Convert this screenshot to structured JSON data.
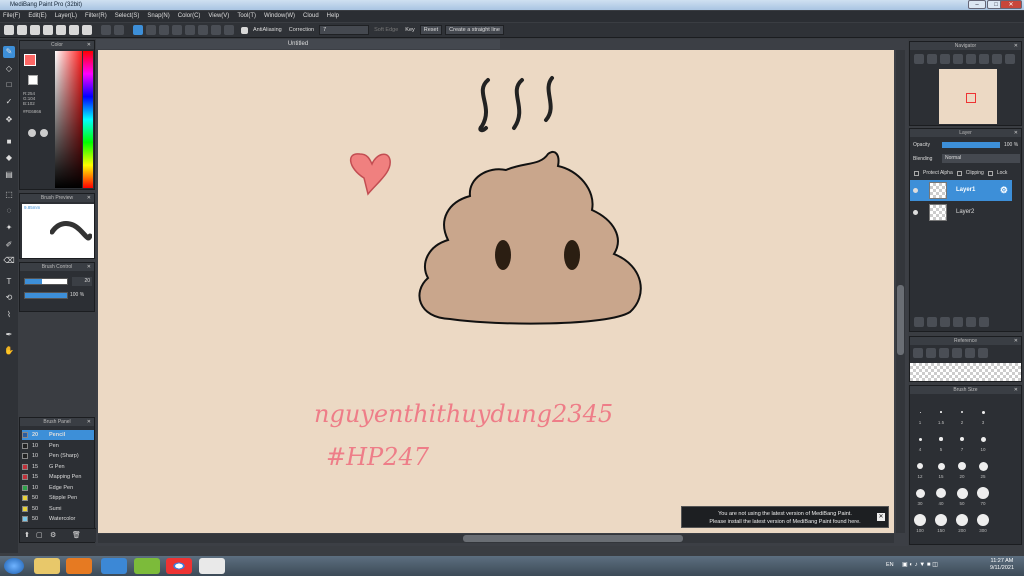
{
  "window": {
    "title": "MediBang Paint Pro (32bit)",
    "tab_title": "Untitled"
  },
  "menu": [
    "File(F)",
    "Edit(E)",
    "Layer(L)",
    "Filter(R)",
    "Select(S)",
    "Snap(N)",
    "Color(C)",
    "View(V)",
    "Tool(T)",
    "Window(W)",
    "Cloud",
    "Help"
  ],
  "toolbar": {
    "antialiasing": "AntiAliasing",
    "correction_label": "Correction",
    "correction_value": "7",
    "soft_edge": "Soft Edge",
    "key_label": "Key",
    "reset_label": "Reset",
    "straight_line": "Create a straight line"
  },
  "color_panel": {
    "title": "Color",
    "r": "R:254",
    "g": "G:104",
    "b": "B:102",
    "hex": "#FE6866",
    "fg": "#fe6866"
  },
  "brush_preview": {
    "title": "Brush Preview",
    "size": "9.85mm"
  },
  "brush_control": {
    "title": "Brush Control",
    "size": "20",
    "opacity": "100 %"
  },
  "brush_panel": {
    "title": "Brush Panel",
    "items": [
      {
        "size": "20",
        "name": "Pencil",
        "color": "#2a5ea0"
      },
      {
        "size": "10",
        "name": "Pen",
        "color": "#222222"
      },
      {
        "size": "10",
        "name": "Pen (Sharp)",
        "color": "#222222"
      },
      {
        "size": "15",
        "name": "G Pen",
        "color": "#c0303a"
      },
      {
        "size": "15",
        "name": "Mapping Pen",
        "color": "#c0303a"
      },
      {
        "size": "10",
        "name": "Edge Pen",
        "color": "#2ea24a"
      },
      {
        "size": "50",
        "name": "Stipple Pen",
        "color": "#e8d23a"
      },
      {
        "size": "50",
        "name": "Sumi",
        "color": "#e8d23a"
      },
      {
        "size": "50",
        "name": "Watercolor",
        "color": "#7ac6e8"
      }
    ]
  },
  "navigator": {
    "title": "Navigator"
  },
  "layer_panel": {
    "title": "Layer",
    "opacity_label": "Opacity",
    "opacity_value": "100 %",
    "blending_label": "Blending",
    "blending_value": "Normal",
    "protect_alpha": "Protect Alpha",
    "clipping": "Clipping",
    "lock": "Lock",
    "layers": [
      "Layer1",
      "Layer2"
    ]
  },
  "reference": {
    "title": "Reference"
  },
  "brush_size": {
    "title": "Brush Size",
    "labels": [
      "1",
      "1.5",
      "2",
      "3",
      "4",
      "5",
      "7",
      "10",
      "12",
      "15",
      "20",
      "25",
      "30",
      "40",
      "50",
      "70",
      "100",
      "150",
      "200",
      "300"
    ]
  },
  "canvas": {
    "handwriting_line1": "nguyenthithuydung2345",
    "handwriting_line2": "#HP247"
  },
  "notification": {
    "line1": "You are not using the latest version of MediBang Paint.",
    "line2": "Please install the latest version of MediBang Paint found here."
  },
  "taskbar": {
    "lang": "EN",
    "time": "11:27 AM",
    "date": "9/11/2021"
  }
}
